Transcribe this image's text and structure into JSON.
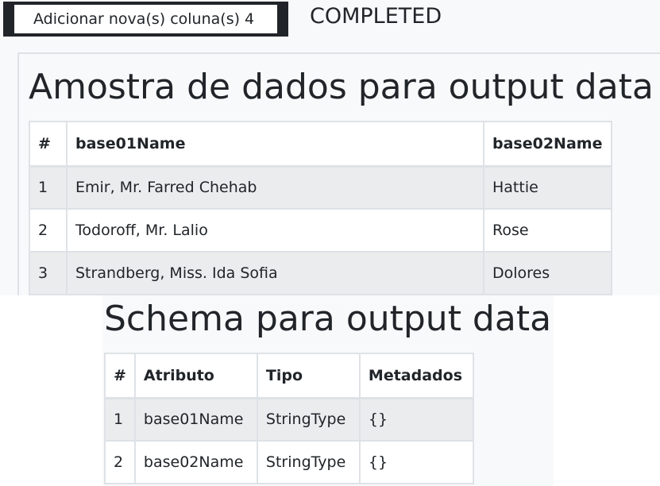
{
  "toolbar": {
    "add_columns_label": "Adicionar nova(s) coluna(s) 4",
    "status": "COMPLETED"
  },
  "sample": {
    "title": "Amostra de dados para output data",
    "headers": [
      "#",
      "base01Name",
      "base02Name"
    ],
    "rows": [
      [
        "1",
        "Emir, Mr. Farred Chehab",
        "Hattie"
      ],
      [
        "2",
        "Todoroff, Mr. Lalio",
        "Rose"
      ],
      [
        "3",
        "Strandberg, Miss. Ida Sofia",
        "Dolores"
      ]
    ]
  },
  "schema": {
    "title": "Schema para output data",
    "headers": [
      "#",
      "Atributo",
      "Tipo",
      "Metadados"
    ],
    "rows": [
      [
        "1",
        "base01Name",
        "StringType",
        "{}"
      ],
      [
        "2",
        "base02Name",
        "StringType",
        "{}"
      ]
    ]
  }
}
